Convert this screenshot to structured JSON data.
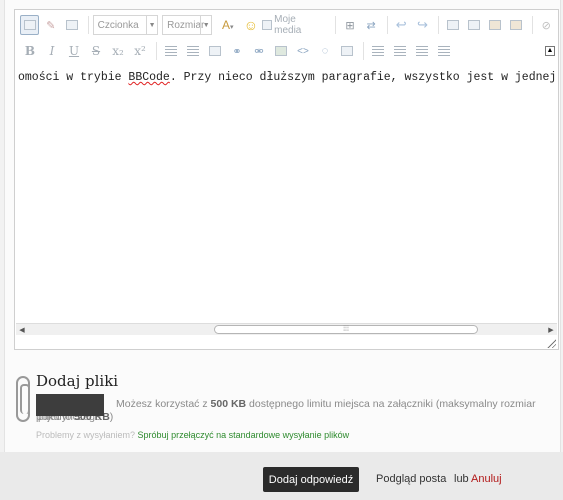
{
  "toolbar": {
    "font_select": "Czcionka",
    "size_select": "Rozmiar",
    "media_label": "Moje media",
    "bold": "B",
    "italic": "I",
    "underline": "U",
    "strike": "S",
    "subscript": "x₂",
    "superscript": "x²",
    "collapse": "▲"
  },
  "editor": {
    "text_before": "omości w trybie ",
    "text_spell": "BBCode",
    "text_after": ". Przy nieco dłuższym paragrafie, wszystko jest w jednej linii z"
  },
  "scrollbar": {
    "left_arrow": "◀",
    "right_arrow": "▶",
    "thumb_grip": "⁞⁞⁞"
  },
  "attachments": {
    "title": "Dodaj pliki",
    "info_prefix": "Możesz korzystać z ",
    "info_limit": "500 KB",
    "info_middle": " dostępnego limitu miejsca na załączniki (maksymalny rozmiar pojedynczego",
    "info_tail_prefix": "pliku to ",
    "info_tail_limit": "500 KB",
    "info_tail_suffix": ")",
    "help_prefix": "Problemy z wysyłaniem?",
    "help_link": "Spróbuj przełączyć na standardowe wysyłanie plików"
  },
  "footer": {
    "submit": "Dodaj odpowiedź",
    "preview": "Podgląd posta",
    "or": "lub",
    "cancel": "Anuluj"
  }
}
